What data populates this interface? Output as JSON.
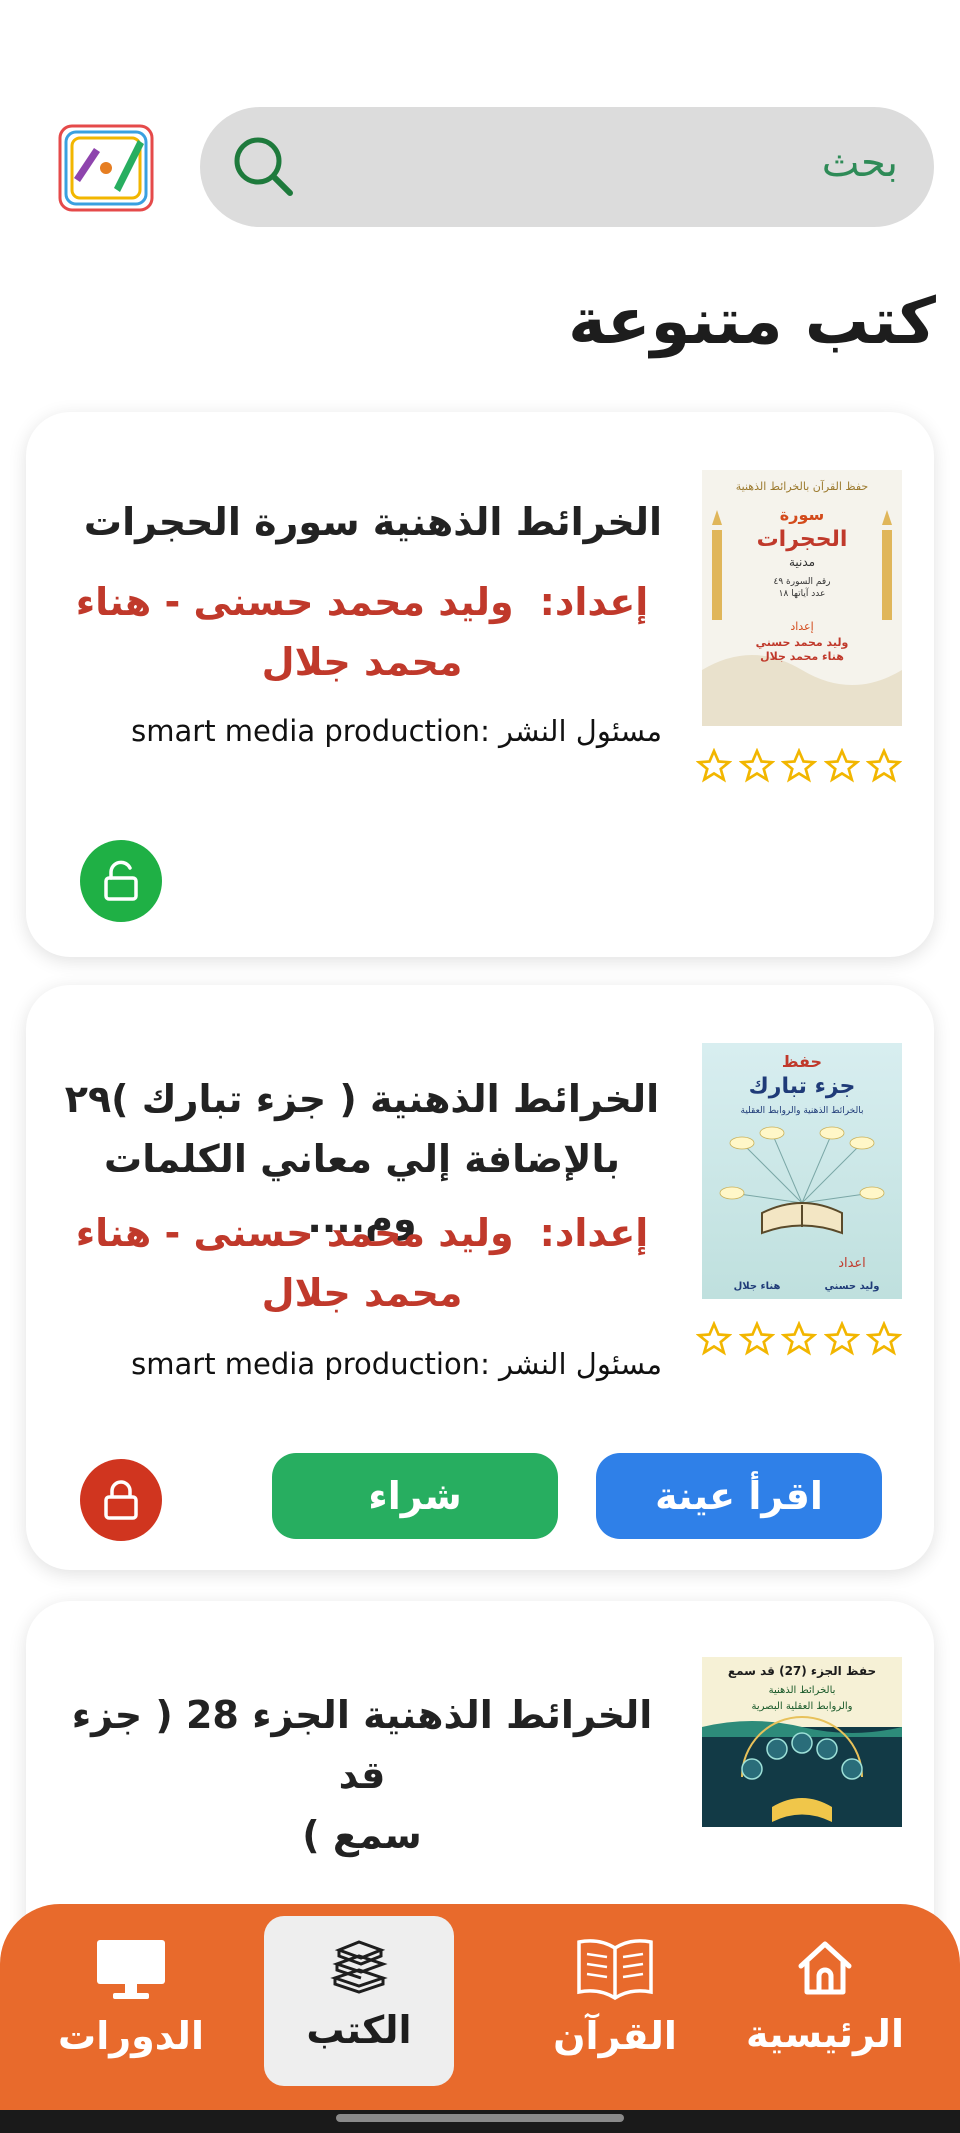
{
  "search": {
    "placeholder": "بحث"
  },
  "logo": {
    "alt_text": "ورقة و قلم"
  },
  "section": {
    "title": "كتب متنوعة"
  },
  "books": [
    {
      "title": "الخرائط الذهنية سورة الحجرات",
      "author_label": "إعداد:",
      "author_line1": "وليد محمد حسنى - هناء",
      "author_line2": "محمد جلال",
      "publisher": "مسئول النشر :smart media production",
      "rating": 0,
      "locked": false
    },
    {
      "title_line1": "الخرائط الذهنية ( جزء  تبارك )٢٩",
      "title_line2": "بالإضافة إلي معاني الكلمات وم....",
      "author_label": "إعداد:",
      "author_line1": "وليد محمد حسنى - هناء",
      "author_line2": "محمد جلال",
      "publisher": "مسئول النشر :smart media production",
      "rating": 0,
      "locked": true,
      "read_sample_label": "اقرأ عينة",
      "buy_label": "شراء"
    },
    {
      "title_line1": "الخرائط الذهنية الجزء 28 ( جزء قد",
      "title_line2": "سمع )"
    }
  ],
  "covers": {
    "hujurat": {
      "top_line": "حفظ القرآن بالخرائط الذهنية",
      "surah_label": "سورة",
      "surah_name": "الحجرات",
      "type": "مدنية",
      "info1": "رقم السورة ٤٩",
      "info2": "عدد آياتها ١٨",
      "prep": "إعداد",
      "authors1": "وليد محمد حسني",
      "authors2": "هناء محمد جلال"
    },
    "tabarak": {
      "hifz": "حفظ",
      "name": "جزء تبارك",
      "sub": "بالخرائط الذهنية والروابط العقلية",
      "prep": "اعداد",
      "a1": "وليد حسني",
      "a2": "هناء جلال"
    },
    "qadsami": {
      "line1": "حفظ الجزء (27) قد سمع",
      "line2": "بالخرائط الذهنية",
      "line3": "والروابط العقلية البصرية"
    }
  },
  "nav": {
    "items": [
      {
        "label": "الرئيسية",
        "icon": "home-icon"
      },
      {
        "label": "القرآن",
        "icon": "quran-book-icon"
      },
      {
        "label": "الكتب",
        "icon": "books-stack-icon",
        "active": true
      },
      {
        "label": "الدورات",
        "icon": "monitor-icon"
      }
    ]
  },
  "colors": {
    "accent_orange": "#e86a2c",
    "author_red": "#c0392b",
    "buy_green": "#27ae60",
    "read_blue": "#2f80e8",
    "unlock_green": "#1fb045",
    "lock_red": "#d0351f",
    "star_gold": "#f2b600"
  }
}
